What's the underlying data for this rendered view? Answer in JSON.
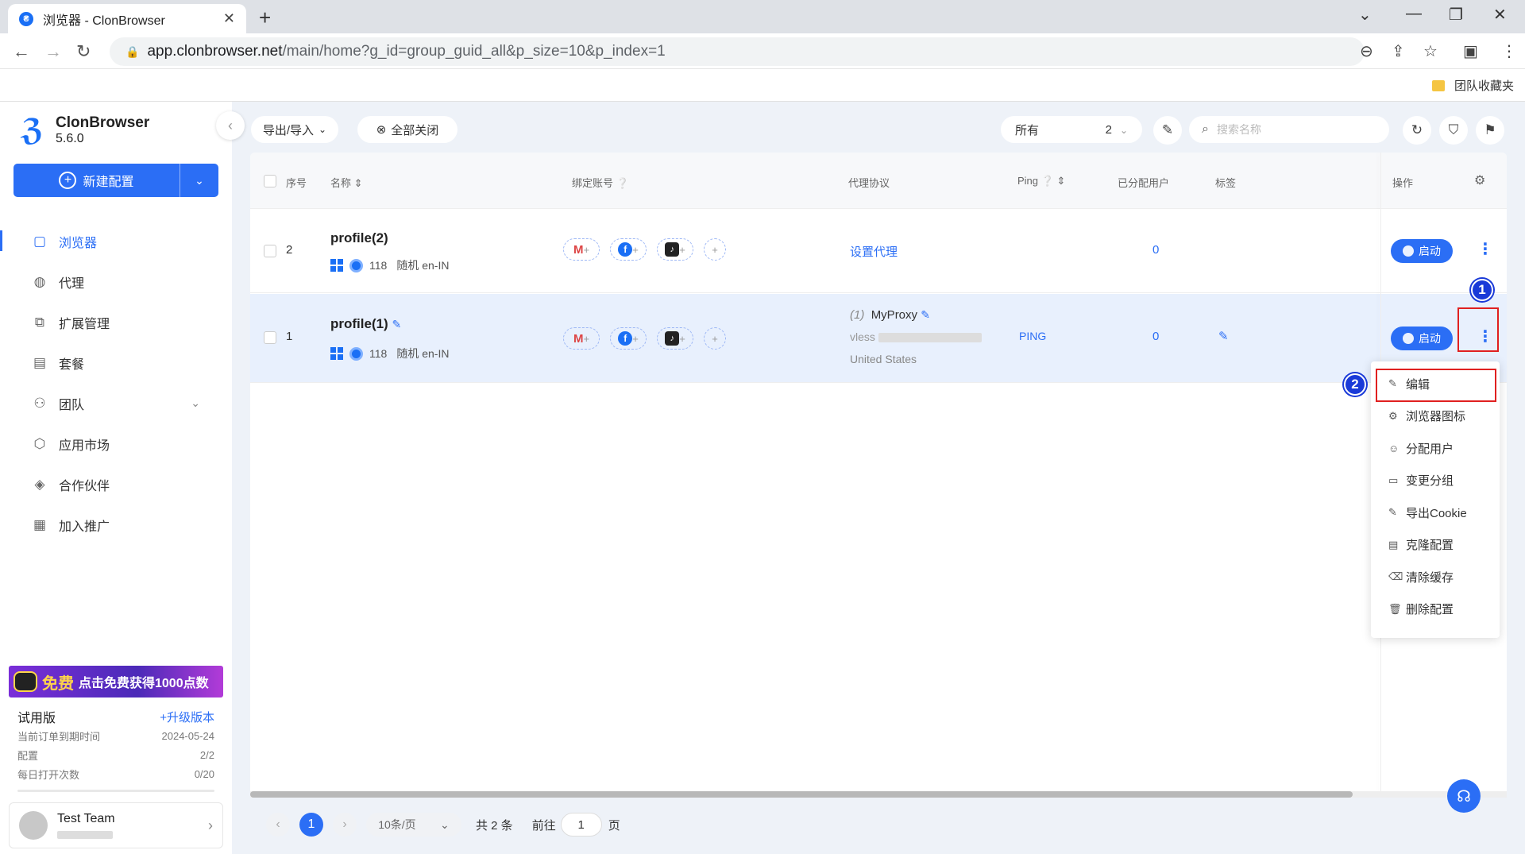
{
  "browser": {
    "tab_title": "浏览器 - ClonBrowser",
    "url_host": "app.clonbrowser.net",
    "url_path": "/main/home?g_id=group_guid_all&p_size=10&p_index=1",
    "bookmark": "团队收藏夹"
  },
  "brand": {
    "name": "ClonBrowser",
    "version": "5.6.0"
  },
  "sidebar": {
    "new_button": "新建配置",
    "items": [
      {
        "label": "浏览器",
        "icon": "browser-icon"
      },
      {
        "label": "代理",
        "icon": "globe-icon"
      },
      {
        "label": "扩展管理",
        "icon": "puzzle-icon"
      },
      {
        "label": "套餐",
        "icon": "wallet-icon"
      },
      {
        "label": "团队",
        "icon": "team-icon"
      },
      {
        "label": "应用市场",
        "icon": "cube-icon"
      },
      {
        "label": "合作伙伴",
        "icon": "handshake-icon"
      },
      {
        "label": "加入推广",
        "icon": "promote-icon"
      }
    ],
    "promo": {
      "free": "免费",
      "text": "点击免费获得1000点数"
    },
    "plan": {
      "name": "试用版",
      "upgrade": "+升级版本",
      "expire_label": "当前订单到期时间",
      "expire_value": "2024-05-24",
      "config_label": "配置",
      "config_value": "2/2",
      "daily_label": "每日打开次数",
      "daily_value": "0/20"
    },
    "user": {
      "name": "Test Team"
    }
  },
  "toolbar": {
    "export_import": "导出/导入",
    "close_all": "全部关闭",
    "group_label": "所有",
    "group_count": "2",
    "search_placeholder": "搜索名称"
  },
  "table": {
    "headers": {
      "index": "序号",
      "name": "名称",
      "accounts": "绑定账号",
      "proxy": "代理协议",
      "ping": "Ping",
      "users": "已分配用户",
      "tags": "标签",
      "ops": "操作"
    },
    "rows": [
      {
        "index": "2",
        "name": "profile(2)",
        "version": "118",
        "env": "随机 en-IN",
        "proxy": "设置代理",
        "users": "0",
        "launch": "启动"
      },
      {
        "index": "1",
        "name": "profile(1)",
        "version": "118",
        "env": "随机 en-IN",
        "proxy_index": "(1)",
        "proxy_name": "MyProxy",
        "proxy_type": "vless",
        "proxy_country": "United States",
        "ping": "PING",
        "users": "0",
        "launch": "启动"
      }
    ]
  },
  "dropdown": [
    {
      "label": "编辑",
      "icon": "edit-icon"
    },
    {
      "label": "浏览器图标",
      "icon": "gear-icon"
    },
    {
      "label": "分配用户",
      "icon": "user-icon"
    },
    {
      "label": "变更分组",
      "icon": "folder-icon"
    },
    {
      "label": "导出Cookie",
      "icon": "export-icon"
    },
    {
      "label": "克隆配置",
      "icon": "copy-icon"
    },
    {
      "label": "清除缓存",
      "icon": "clear-icon"
    },
    {
      "label": "删除配置",
      "icon": "trash-icon"
    }
  ],
  "annotations": {
    "one": "1",
    "two": "2"
  },
  "pagination": {
    "current": "1",
    "page_size": "10条/页",
    "total": "共 2 条",
    "goto_prefix": "前往",
    "goto_value": "1",
    "goto_suffix": "页"
  }
}
